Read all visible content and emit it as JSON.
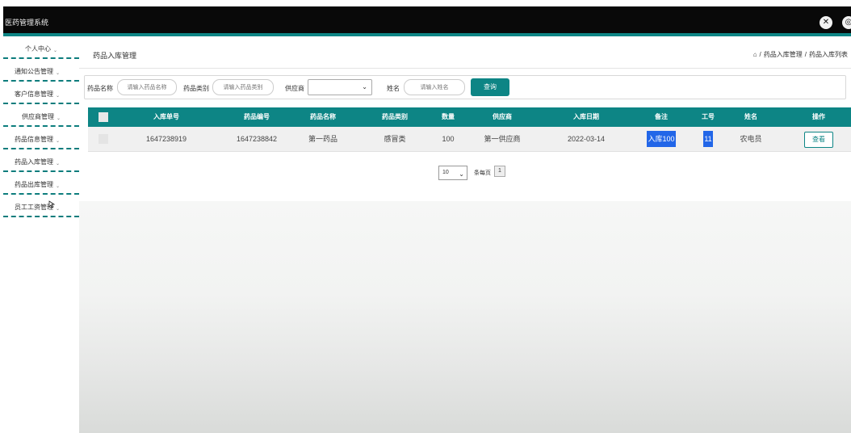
{
  "app": {
    "title": "医药管理系统"
  },
  "sidebar": {
    "items": [
      {
        "label": "个人中心"
      },
      {
        "label": "通知公告管理"
      },
      {
        "label": "客户信息管理"
      },
      {
        "label": "供应商管理"
      },
      {
        "label": "药品信息管理"
      },
      {
        "label": "药品入库管理"
      },
      {
        "label": "药品出库管理"
      },
      {
        "label": "员工工资管理"
      }
    ]
  },
  "page": {
    "title": "药品入库管理",
    "breadcrumb": [
      "药品入库管理",
      "药品入库列表"
    ]
  },
  "search": {
    "name_label": "药品名称",
    "name_placeholder": "请输入药品名称",
    "type_label": "药品类别",
    "type_placeholder": "请输入药品类别",
    "supplier_label": "供应商",
    "supplier_value": "",
    "staff_label": "姓名",
    "staff_placeholder": "请输入姓名",
    "query_button": "查询"
  },
  "table": {
    "columns": [
      "入库单号",
      "药品编号",
      "药品名称",
      "药品类别",
      "数量",
      "供应商",
      "入库日期",
      "备注",
      "工号",
      "姓名",
      "操作"
    ],
    "rows": [
      {
        "order_no": "1647238919",
        "drug_no": "1647238842",
        "drug_name": "第一药品",
        "drug_type": "感冒类",
        "quantity": "100",
        "supplier": "第一供应商",
        "date": "2022-03-14",
        "remark": "入库100",
        "staff_no": "11",
        "staff_name": "农电员",
        "action": "查看"
      }
    ]
  },
  "pager": {
    "page_size": "10",
    "per_page_label": "条每页",
    "current_page": "1"
  },
  "colors": {
    "accent": "#0d8585",
    "topbar": "#090909",
    "highlight": "#2266e8"
  }
}
